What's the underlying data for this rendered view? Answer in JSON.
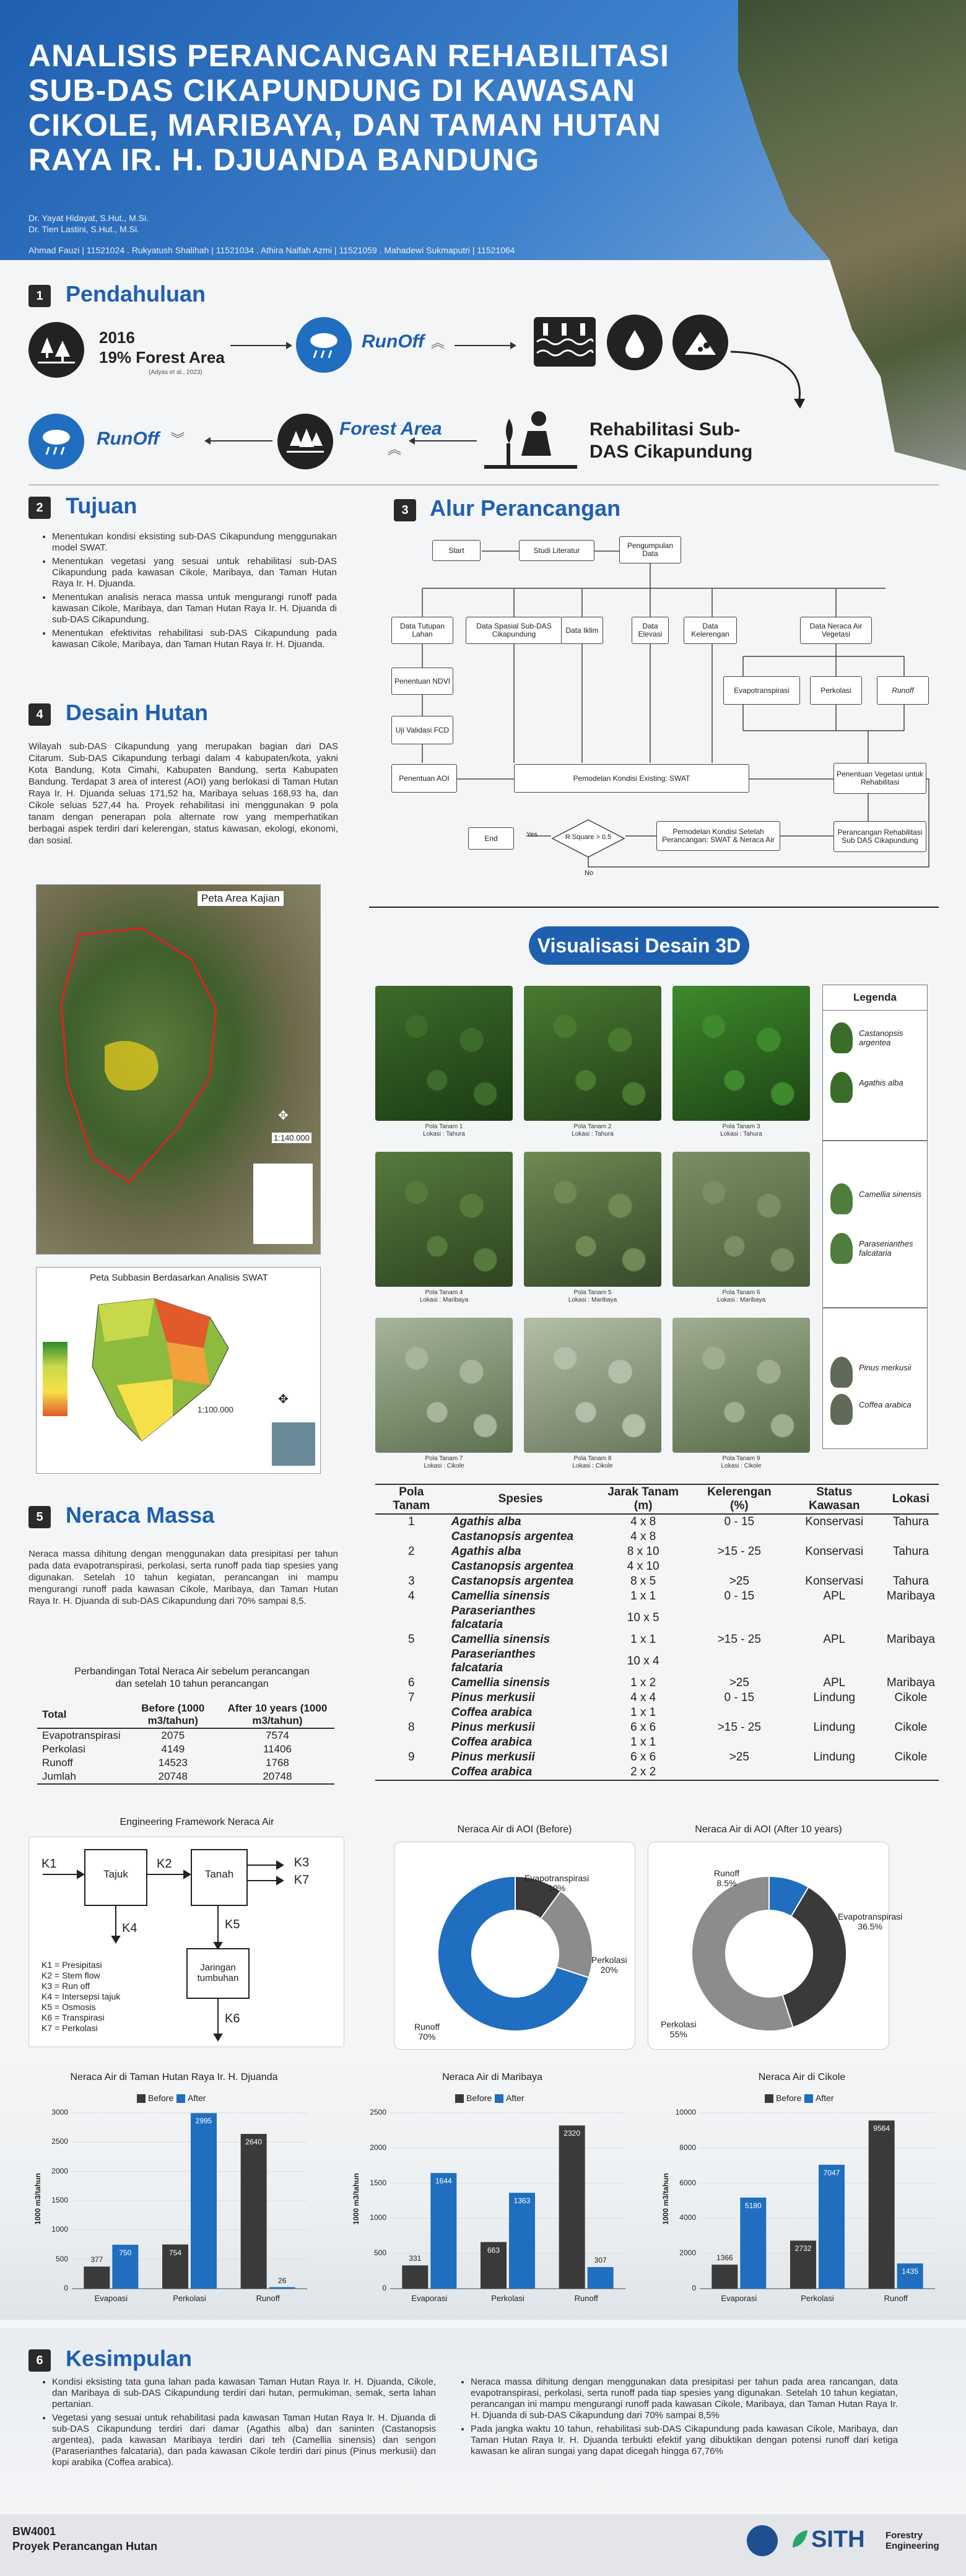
{
  "header": {
    "title": "ANALISIS PERANCANGAN REHABILITASI SUB-DAS CIKAPUNDUNG DI KAWASAN CIKOLE, MARIBAYA, DAN TAMAN HUTAN RAYA IR. H. DJUANDA BANDUNG",
    "advisor1": "Dr. Yayat Hidayat, S.Hut., M.Si.",
    "advisor2": "Dr. Tien Lastini, S.Hut., M.Si.",
    "authors": "Ahmad Fauzi | 11521024 . Rukyatush Shalihah | 11521034 . Athira Nalfah Azmi | 11521059 . Mahadewi Sukmaputri | 11521064"
  },
  "sec1": {
    "num": "1",
    "title": "Pendahuluan",
    "year": "2016",
    "forest": "19% Forest Area",
    "cite": "(Adyas et al., 2023)",
    "runoff_up": "RunOff",
    "rehab": "Rehabilitasi Sub-DAS Cikapundung",
    "runoff_down": "RunOff",
    "forest_area": "Forest Area"
  },
  "sec2": {
    "num": "2",
    "title": "Tujuan",
    "items": [
      "Menentukan kondisi eksisting sub-DAS Cikapundung menggunakan model SWAT.",
      "Menentukan vegetasi yang sesuai untuk rehabilitasi sub-DAS Cikapundung pada kawasan Cikole, Maribaya, dan Taman Hutan Raya Ir. H. Djuanda.",
      "Menentukan analisis neraca massa untuk mengurangi runoff pada kawasan Cikole, Maribaya, dan Taman Hutan Raya Ir. H. Djuanda di sub-DAS Cikapundung.",
      "Menentukan efektivitas rehabilitasi sub-DAS Cikapundung pada kawasan Cikole, Maribaya, dan Taman Hutan Raya Ir. H. Djuanda."
    ]
  },
  "sec3": {
    "num": "3",
    "title": "Alur Perancangan",
    "start": "Start",
    "studi": "Studi Literatur",
    "pengumpulan": "Pengumpulan Data",
    "tutupan": "Data Tutupan Lahan",
    "spasial": "Data Spasial Sub-DAS Cikapundung",
    "iklim": "Data Iklim",
    "elevasi": "Data Elevasi",
    "kelerengan": "Data Kelerengan",
    "neraca": "Data Neraca Air Vegetasi",
    "evapo": "Evapotranspirasi",
    "perkolasi": "Perkolasi",
    "runoff": "Runoff",
    "ndvi": "Penentuan NDVI",
    "fcd": "Uji Validasi FCD",
    "aoi": "Penentuan AOI",
    "swat": "Pemodelan Kondisi Existing: SWAT",
    "vegetasi": "Penentuan Vegetasi untuk Rehabilitasi",
    "end": "End",
    "yes": "Yes",
    "rsq": "R Square > 0.5",
    "no": "No",
    "setelah": "Pemodelan Kondisi Setelah Perancangan: SWAT & Neraca Air",
    "rehab_box": "Perancangan Rehabilitasi Sub DAS Cikapundung"
  },
  "sec4": {
    "num": "4",
    "title": "Desain Hutan",
    "text": "Wilayah sub-DAS Cikapundung yang merupakan bagian dari DAS Citarum. Sub-DAS Cikapundung terbagi dalam 4 kabupaten/kota, yakni Kota Bandung, Kota Cimahi, Kabupaten Bandung, serta Kabupaten Bandung. Terdapat 3 area of interest (AOI) yang berlokasi di Taman Hutan Raya Ir. H. Djuanda seluas 171,52 ha, Maribaya seluas 168,93 ha, dan Cikole seluas 527,44 ha. Proyek rehabilitasi ini menggunakan 9 pola tanam dengan penerapan pola alternate row yang memperhatikan berbagai aspek terdiri dari kelerengan, status kawasan, ekologi, ekonomi, dan sosial.",
    "map1_title": "Peta Area Kajian",
    "map1_scale": "1:140.000",
    "map2_title": "Peta Subbasin Berdasarkan Analisis SWAT",
    "map2_scale": "1:100.000"
  },
  "viz3d": {
    "title": "Visualisasi Desain 3D",
    "legend_title": "Legenda",
    "legend": [
      "Castanopsis argentea",
      "Agathis alba",
      "Camellia sinensis",
      "Paraserianthes falcataria",
      "Pinus merkusii",
      "Coffea arabica"
    ],
    "thumbs": [
      {
        "l1": "Pola Tanam 1",
        "l2": "Lokasi : Tahura",
        "c1": "#3d6b2a",
        "c2": "#1b3b14"
      },
      {
        "l1": "Pola Tanam 2",
        "l2": "Lokasi : Tahura",
        "c1": "#4a7a30",
        "c2": "#223f18"
      },
      {
        "l1": "Pola Tanam 3",
        "l2": "Lokasi : Tahura",
        "c1": "#3e8a2c",
        "c2": "#1c4414"
      },
      {
        "l1": "Pola Tanam 4",
        "l2": "Lokasi : Maribaya",
        "c1": "#567a3c",
        "c2": "#2e4422"
      },
      {
        "l1": "Pola Tanam 5",
        "l2": "Lokasi : Maribaya",
        "c1": "#6f8a52",
        "c2": "#34492a"
      },
      {
        "l1": "Pola Tanam 6",
        "l2": "Lokasi : Maribaya",
        "c1": "#7b8f66",
        "c2": "#4a5e3a"
      },
      {
        "l1": "Pola Tanam 7",
        "l2": "Lokasi : Cikole",
        "c1": "#a7b59b",
        "c2": "#5d7050"
      },
      {
        "l1": "Pola Tanam 8",
        "l2": "Lokasi : Cikole",
        "c1": "#b3bfa8",
        "c2": "#6a7a5c"
      },
      {
        "l1": "Pola Tanam 9",
        "l2": "Lokasi : Cikole",
        "c1": "#9fae90",
        "c2": "#586b4a"
      }
    ]
  },
  "pola": {
    "headers": [
      "Pola Tanam",
      "Spesies",
      "Jarak Tanam (m)",
      "Kelerengan (%)",
      "Status Kawasan",
      "Lokasi"
    ],
    "rows": [
      [
        "1",
        "Agathis alba",
        "4 x 8",
        "0 - 15",
        "Konservasi",
        "Tahura"
      ],
      [
        "",
        "Castanopsis argentea",
        "4 x 8",
        "",
        "",
        ""
      ],
      [
        "2",
        "Agathis alba",
        "8 x 10",
        ">15 - 25",
        "Konservasi",
        "Tahura"
      ],
      [
        "",
        "Castanopsis argentea",
        "4 x 10",
        "",
        "",
        ""
      ],
      [
        "3",
        "Castanopsis argentea",
        "8 x 5",
        ">25",
        "Konservasi",
        "Tahura"
      ],
      [
        "4",
        "Camellia sinensis",
        "1 x 1",
        "0 - 15",
        "APL",
        "Maribaya"
      ],
      [
        "",
        "Paraserianthes falcataria",
        "10 x 5",
        "",
        "",
        ""
      ],
      [
        "5",
        "Camellia sinensis",
        "1 x 1",
        ">15 - 25",
        "APL",
        "Maribaya"
      ],
      [
        "",
        "Paraserianthes falcataria",
        "10 x 4",
        "",
        "",
        ""
      ],
      [
        "6",
        "Camellia sinensis",
        "1 x 2",
        ">25",
        "APL",
        "Maribaya"
      ],
      [
        "7",
        "Pinus merkusii",
        "4 x 4",
        "0 - 15",
        "Lindung",
        "Cikole"
      ],
      [
        "",
        "Coffea arabica",
        "1 x 1",
        "",
        "",
        ""
      ],
      [
        "8",
        "Pinus merkusii",
        "6 x 6",
        ">15 - 25",
        "Lindung",
        "Cikole"
      ],
      [
        "",
        "Coffea arabica",
        "1 x 1",
        "",
        "",
        ""
      ],
      [
        "9",
        "Pinus merkusii",
        "6 x 6",
        ">25",
        "Lindung",
        "Cikole"
      ],
      [
        "",
        "Coffea arabica",
        "2 x 2",
        "",
        "",
        ""
      ]
    ]
  },
  "sec5": {
    "num": "5",
    "title": "Neraca Massa",
    "text": "Neraca massa dihitung dengan menggunakan data presipitasi per tahun pada data evapotranspirasi, perkolasi, serta runoff pada tiap spesies yang digunakan. Setelah 10 tahun kegiatan, perancangan ini mampu mengurangi runoff pada kawasan Cikole, Maribaya, dan Taman Hutan Raya Ir. H. Djuanda di sub-DAS Cikapundung dari 70% sampai 8,5.",
    "table_title": "Perbandingan Total Neraca Air sebelum perancangan dan setelah 10 tahun perancangan",
    "headers": [
      "Total",
      "Before (1000 m3/tahun)",
      "After 10 years (1000 m3/tahun)"
    ],
    "rows": [
      [
        "Evapotranspirasi",
        "2075",
        "7574"
      ],
      [
        "Perkolasi",
        "4149",
        "11406"
      ],
      [
        "Runoff",
        "14523",
        "1768"
      ],
      [
        "Jumlah",
        "20748",
        "20748"
      ]
    ]
  },
  "framework": {
    "title": "Engineering Framework Neraca Air",
    "k1": "K1",
    "k2": "K2",
    "k3": "K3",
    "k4": "K4",
    "k5": "K5",
    "k6": "K6",
    "k7": "K7",
    "tajuk": "Tajuk",
    "tanah": "Tanah",
    "jaringan": "Jaringan tumbuhan",
    "legend": [
      "K1 = Presipitasi",
      "K2 = Stem flow",
      "K3 = Run off",
      "K4 = Intersepsi tajuk",
      "K5 = Osmosis",
      "K6 = Transpirasi",
      "K7 = Perkolasi"
    ]
  },
  "donuts": [
    {
      "title": "Neraca Air di AOI (Before)",
      "labels": [
        "Evapotranspirasi",
        "Perkolasi",
        "Runoff"
      ],
      "pct_labels": [
        "10%",
        "20%",
        "70%"
      ],
      "values": [
        10,
        20,
        70
      ],
      "colors": [
        "#3a3a3a",
        "#8c8c8c",
        "#1f6ec0"
      ]
    },
    {
      "title": "Neraca Air di AOI (After 10 years)",
      "labels": [
        "Runoff",
        "Evapotranspirasi",
        "Perkolasi"
      ],
      "pct_labels": [
        "8.5%",
        "36.5%",
        "55%"
      ],
      "values": [
        8.5,
        36.5,
        55
      ],
      "colors": [
        "#1f6ec0",
        "#3a3a3a",
        "#8c8c8c"
      ]
    }
  ],
  "chart_data": [
    {
      "type": "bar",
      "title": "Neraca Air di Taman Hutan Raya Ir. H. Djuanda",
      "categories": [
        "Evapoasi",
        "Perkolasi",
        "Runoff"
      ],
      "series": [
        {
          "name": "Before",
          "values": [
            377,
            754,
            2640
          ]
        },
        {
          "name": "After",
          "values": [
            750,
            2995,
            26
          ]
        }
      ],
      "ylabel": "1000 m3/tahun",
      "ylim": [
        0,
        3000
      ],
      "yticks": [
        0,
        500,
        1000,
        1500,
        2000,
        2500,
        3000
      ]
    },
    {
      "type": "bar",
      "title": "Neraca Air di Maribaya",
      "categories": [
        "Evaporasi",
        "Perkolasi",
        "Runoff"
      ],
      "series": [
        {
          "name": "Before",
          "values": [
            331,
            663,
            2320
          ]
        },
        {
          "name": "After",
          "values": [
            1644,
            1363,
            307
          ]
        }
      ],
      "ylabel": "1000 m3/tahun",
      "ylim": [
        0,
        2500
      ],
      "yticks": [
        0,
        500,
        1000,
        1500,
        2000,
        2500
      ]
    },
    {
      "type": "bar",
      "title": "Neraca Air di Cikole",
      "categories": [
        "Evaporasi",
        "Perkolasi",
        "Runoff"
      ],
      "series": [
        {
          "name": "Before",
          "values": [
            1366,
            2732,
            9564
          ]
        },
        {
          "name": "After",
          "values": [
            5180,
            7047,
            1435
          ]
        }
      ],
      "ylabel": "1000 m3/tahun",
      "ylim": [
        0,
        10000
      ],
      "yticks": [
        0,
        2000,
        4000,
        6000,
        8000,
        10000
      ]
    }
  ],
  "sec6": {
    "num": "6",
    "title": "Kesimpulan",
    "left": [
      "Kondisi eksisting tata guna lahan pada kawasan Taman Hutan Raya Ir. H. Djuanda, Cikole, dan Maribaya di sub-DAS Cikapundung terdiri dari hutan, permukiman, semak, serta lahan pertanian.",
      "Vegetasi yang sesuai untuk rehabilitasi pada kawasan Taman Hutan Raya Ir. H. Djuanda di sub-DAS Cikapundung terdiri dari damar (Agathis alba) dan saninten (Castanopsis argentea), pada kawasan Maribaya terdiri dari teh (Camellia sinensis) dan sengon (Paraserianthes falcataria), dan pada kawasan Cikole terdiri dari pinus (Pinus merkusii) dan kopi arabika (Coffea arabica)."
    ],
    "right": [
      "Neraca massa dihitung dengan menggunakan data presipitasi per tahun pada area rancangan, data evapotranspirasi, perkolasi, serta runoff pada tiap spesies yang digunakan. Setelah 10 tahun kegiatan, perancangan ini mampu mengurangi runoff pada kawasan Cikole, Maribaya, dan Taman Hutan Raya Ir. H. Djuanda di sub-DAS Cikapundung dari 70% sampai 8,5%",
      "Pada jangka waktu 10 tahun, rehabilitasi sub-DAS Cikapundung pada kawasan Cikole, Maribaya, dan Taman Hutan Raya Ir. H. Djuanda terbukti efektif yang dibuktikan dengan potensi runoff dari ketiga kawasan ke aliran sungai yang dapat dicegah hingga 67,76%"
    ]
  },
  "footer": {
    "code": "BW4001",
    "course": "Proyek Perancangan Hutan",
    "logo": "SITH",
    "logo_sub": "Forestry Engineering"
  },
  "colors": {
    "blue": "#1f6ec0",
    "dark": "#3a3a3a",
    "grey": "#8c8c8c"
  }
}
